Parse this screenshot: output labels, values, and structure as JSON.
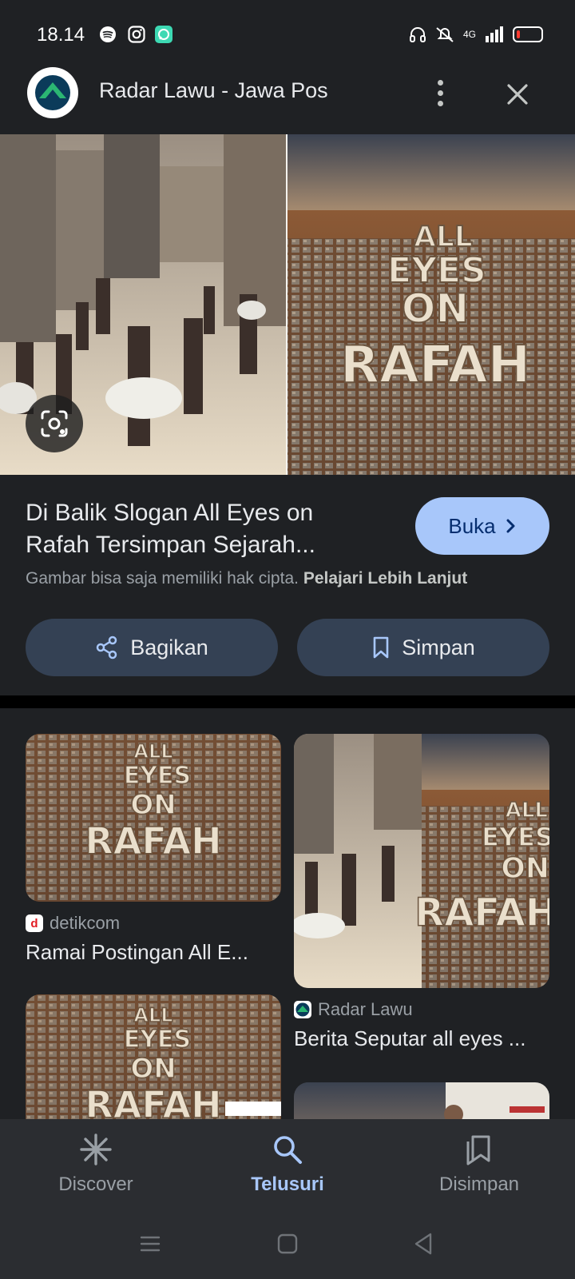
{
  "status_bar": {
    "time": "18.14",
    "network": "4G",
    "battery_level": 0.1,
    "app_icons": [
      "spotify-icon",
      "instagram-icon",
      "chat-app-icon"
    ],
    "right_icons": [
      "headset-icon",
      "mute-icon",
      "signal-icon",
      "battery-icon"
    ]
  },
  "header": {
    "source_name": "Radar Lawu - Jawa Pos",
    "logo_icon": "radar-lawu-logo",
    "more_icon": "more-vert-icon",
    "close_icon": "close-icon"
  },
  "hero": {
    "left_image": "crowd-walking-through-rubble",
    "right_image": "aerial-tents-all-eyes-on-rafah",
    "overlay_text": [
      "ALL",
      "EYES",
      "ON",
      "RAFAH"
    ],
    "lens_icon": "lens-search-icon"
  },
  "result": {
    "title": "Di Balik Slogan All Eyes on Rafah Tersimpan Sejarah...",
    "open_label": "Buka",
    "copyright_text": "Gambar bisa saja memiliki hak cipta.",
    "learn_more": "Pelajari Lebih Lanjut",
    "share_label": "Bagikan",
    "save_label": "Simpan"
  },
  "related": [
    {
      "source": "detikcom",
      "title": "Ramai Postingan All E...",
      "favicon_letter": "d",
      "favicon_color": "#e21b22"
    },
    {
      "source": "Radar Lawu",
      "title": "Berita Seputar all eyes ...",
      "favicon_color": "#1a6b4a"
    },
    {
      "overlay_text": [
        "ALL",
        "EYES",
        "ON",
        "RAFAH"
      ]
    }
  ],
  "bottom_nav": {
    "discover": "Discover",
    "search": "Telusuri",
    "saved": "Disimpan",
    "active": "search"
  },
  "colors": {
    "background": "#1f2124",
    "accent": "#a8c7fa",
    "button_secondary": "#344154",
    "nav_bg": "#2b2d31"
  }
}
